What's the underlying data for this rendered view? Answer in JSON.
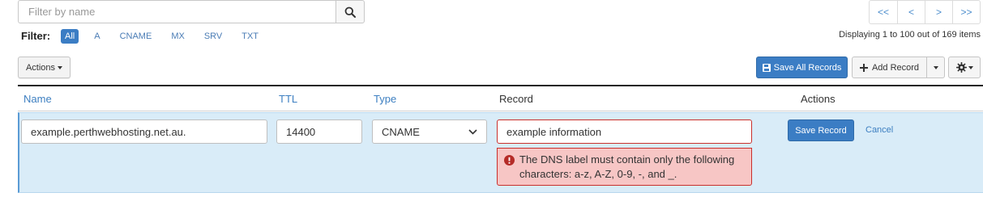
{
  "search": {
    "placeholder": "Filter by name"
  },
  "pager": {
    "first": "<<",
    "prev": "<",
    "next": ">",
    "last": ">>"
  },
  "filter": {
    "label": "Filter:",
    "options": [
      "All",
      "A",
      "CNAME",
      "MX",
      "SRV",
      "TXT"
    ],
    "active": "All"
  },
  "displaying": "Displaying 1 to 100 out of 169 items",
  "toolbar": {
    "actions_label": "Actions",
    "save_all_label": "Save All Records",
    "add_record_label": "Add Record"
  },
  "table": {
    "headers": {
      "name": "Name",
      "ttl": "TTL",
      "type": "Type",
      "record": "Record",
      "actions": "Actions"
    }
  },
  "edit_row": {
    "name": "example.perthwebhosting.net.au.",
    "ttl": "14400",
    "type": "CNAME",
    "record": "example information",
    "error": "The DNS label must contain only the following characters: a-z, A-Z, 0-9, -, and _.",
    "save_label": "Save Record",
    "cancel_label": "Cancel"
  },
  "colors": {
    "accent": "#3b7dc4",
    "link": "#3d7fc1",
    "edit_row_bg": "#d9ecf8",
    "error_bg": "#f7c6c5",
    "error_border": "#c9302c"
  }
}
